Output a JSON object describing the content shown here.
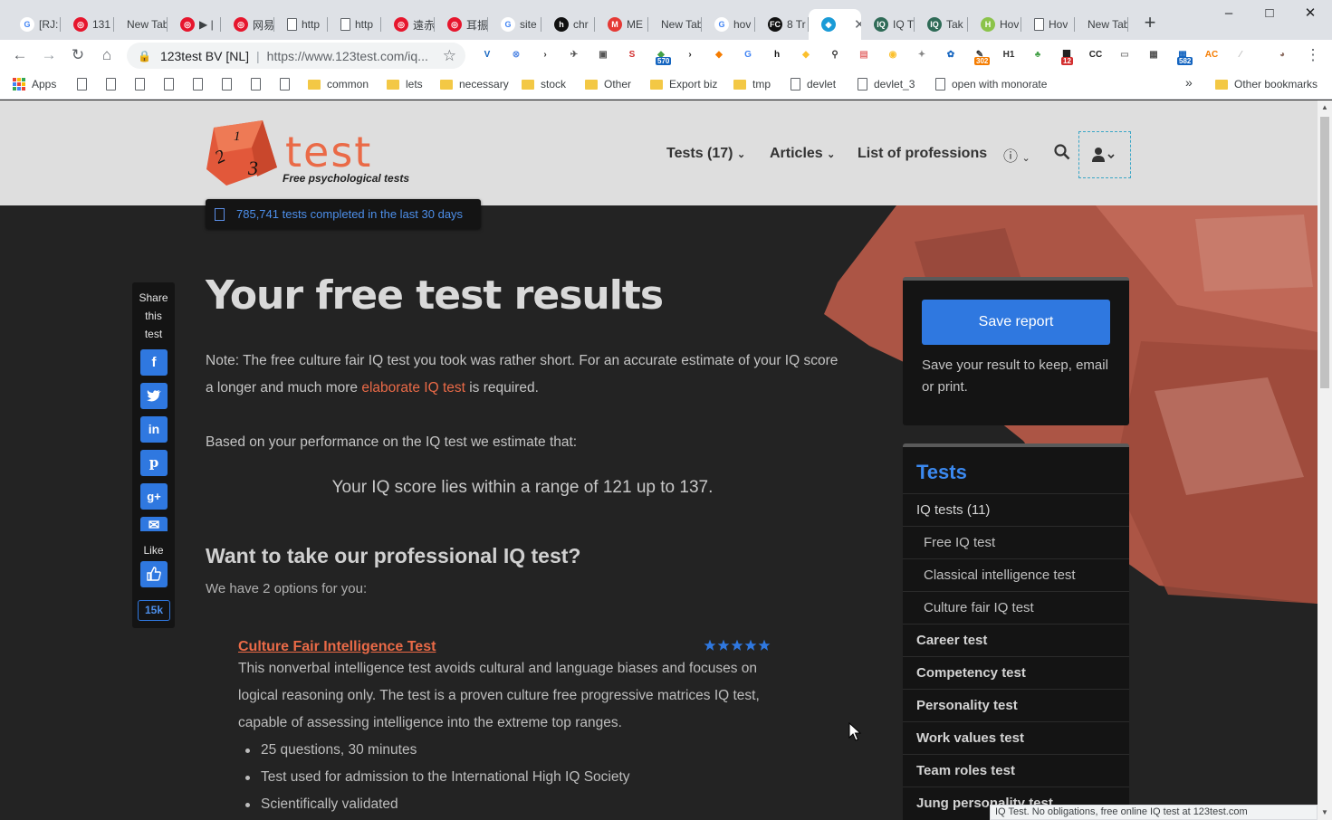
{
  "browser": {
    "tabs": [
      {
        "title": "[RJ:",
        "icon": "google-icon",
        "color": "#4285f4"
      },
      {
        "title": "131",
        "icon": "weibo-icon",
        "color": "#e6162d"
      },
      {
        "title": "New Tab",
        "icon": "none",
        "color": ""
      },
      {
        "title": "▶ |",
        "icon": "weibo-icon",
        "color": "#e6162d"
      },
      {
        "title": "网易",
        "icon": "weibo-icon",
        "color": "#e6162d"
      },
      {
        "title": "http",
        "icon": "page-icon",
        "color": ""
      },
      {
        "title": "http",
        "icon": "page-icon",
        "color": ""
      },
      {
        "title": "遠赤",
        "icon": "weibo-icon",
        "color": "#e6162d"
      },
      {
        "title": "耳振",
        "icon": "weibo-icon",
        "color": "#e6162d"
      },
      {
        "title": "site",
        "icon": "google-icon",
        "color": "#4285f4"
      },
      {
        "title": "chr",
        "icon": "h-icon",
        "color": "#111111"
      },
      {
        "title": "ME",
        "icon": "m-icon",
        "color": "#e53935"
      },
      {
        "title": "New Tab",
        "icon": "none",
        "color": ""
      },
      {
        "title": "hov",
        "icon": "google-icon",
        "color": "#4285f4"
      },
      {
        "title": "8 Tr",
        "icon": "fc-icon",
        "color": "#111111"
      },
      {
        "title": "",
        "icon": "cube-icon",
        "color": "#1a9bd7",
        "active": true
      },
      {
        "title": "IQ T",
        "icon": "iq-icon",
        "color": "#2f6b57"
      },
      {
        "title": "Tak",
        "icon": "iq-icon",
        "color": "#2f6b57"
      },
      {
        "title": "Hov",
        "icon": "wikihow-icon",
        "color": "#8bc34a"
      },
      {
        "title": "Hov",
        "icon": "page-icon",
        "color": ""
      },
      {
        "title": "New Tab",
        "icon": "none",
        "color": ""
      }
    ],
    "omnibox": {
      "org": "123test BV [NL]",
      "url": "https://www.123test.com/iq..."
    },
    "extensions": [
      {
        "icon": "v-extension-icon",
        "text": "V",
        "color": "#1565c0",
        "badge": ""
      },
      {
        "icon": "circle-x-extension-icon",
        "text": "⊗",
        "color": "#5b8ee6",
        "badge": ""
      },
      {
        "icon": "arrow-extension-icon",
        "text": "›",
        "color": "#333333",
        "badge": ""
      },
      {
        "icon": "bird-extension-icon",
        "text": "✈",
        "color": "#555555",
        "badge": ""
      },
      {
        "icon": "copy-extension-icon",
        "text": "▣",
        "color": "#555555",
        "badge": ""
      },
      {
        "icon": "seo-extension-icon",
        "text": "S",
        "color": "#d32f2f",
        "badge": ""
      },
      {
        "icon": "robot-extension-icon",
        "text": "◆",
        "color": "#43a047",
        "badge": "570"
      },
      {
        "icon": "play-extension-icon",
        "text": "›",
        "color": "#222222",
        "badge": ""
      },
      {
        "icon": "fox-extension-icon",
        "text": "◆",
        "color": "#f57c00",
        "badge": ""
      },
      {
        "icon": "translate-extension-icon",
        "text": "G",
        "color": "#4285f4",
        "badge": ""
      },
      {
        "icon": "h-extension-icon",
        "text": "h",
        "color": "#111111",
        "badge": ""
      },
      {
        "icon": "diamond-extension-icon",
        "text": "◆",
        "color": "#fbc02d",
        "badge": ""
      },
      {
        "icon": "magnifier-extension-icon",
        "text": "⚲",
        "color": "#333333",
        "badge": ""
      },
      {
        "icon": "calendar-extension-icon",
        "text": "▤",
        "color": "#e57373",
        "badge": ""
      },
      {
        "icon": "shield-extension-icon",
        "text": "◉",
        "color": "#fbc02d",
        "badge": ""
      },
      {
        "icon": "puzzle-extension-icon",
        "text": "✦",
        "color": "#888888",
        "badge": ""
      },
      {
        "icon": "globe-extension-icon",
        "text": "✿",
        "color": "#1565c0",
        "badge": ""
      },
      {
        "icon": "pen-extension-icon",
        "text": "✎",
        "color": "#333333",
        "badge": "302"
      },
      {
        "icon": "h1-extension-icon",
        "text": "H1",
        "color": "#333333",
        "badge": ""
      },
      {
        "icon": "clover-extension-icon",
        "text": "♣",
        "color": "#43a047",
        "badge": ""
      },
      {
        "icon": "notes-extension-icon",
        "text": "▇",
        "color": "#222222",
        "badge": "12"
      },
      {
        "icon": "cc-extension-icon",
        "text": "CC",
        "color": "#222222",
        "badge": ""
      },
      {
        "icon": "box-extension-icon",
        "text": "▭",
        "color": "#888888",
        "badge": ""
      },
      {
        "icon": "calc-extension-icon",
        "text": "▦",
        "color": "#555555",
        "badge": ""
      },
      {
        "icon": "table-extension-icon",
        "text": "▦",
        "color": "#1565c0",
        "badge": "582"
      },
      {
        "icon": "ac-extension-icon",
        "text": "AC",
        "color": "#f57c00",
        "badge": ""
      },
      {
        "icon": "feather-extension-icon",
        "text": "⁄",
        "color": "#bbbbbb",
        "badge": ""
      },
      {
        "icon": "avatar-icon",
        "text": "◕",
        "color": "#8d6e63",
        "badge": ""
      }
    ],
    "bookmarks": {
      "apps_label": "Apps",
      "page_items": 8,
      "items": [
        {
          "label": "common",
          "type": "folder"
        },
        {
          "label": "lets",
          "type": "folder"
        },
        {
          "label": "necessary",
          "type": "folder"
        },
        {
          "label": "stock",
          "type": "folder"
        },
        {
          "label": "Other",
          "type": "folder"
        },
        {
          "label": "Export biz",
          "type": "folder"
        },
        {
          "label": "tmp",
          "type": "folder"
        },
        {
          "label": "devlet",
          "type": "page"
        },
        {
          "label": "devlet_3",
          "type": "page"
        },
        {
          "label": "open with monorate",
          "type": "page"
        }
      ],
      "overflow": "»",
      "other_label": "Other bookmarks"
    },
    "status_text": "IQ Test. No obligations, free online IQ test at 123test.com"
  },
  "site": {
    "logo": {
      "text": "test",
      "tagline": "Free psychological tests",
      "cube_digits": [
        "1",
        "2",
        "3"
      ],
      "accent": "#ea6a47"
    },
    "nav": {
      "tests": "Tests (17)",
      "articles": "Articles",
      "professions": "List of professions"
    },
    "counter": "785,741 tests completed in the last 30 days",
    "share": {
      "label_lines": [
        "Share",
        "this",
        "test"
      ],
      "like_label": "Like",
      "like_count": "15k"
    },
    "main": {
      "title": "Your free test results",
      "note_before": "Note: The free culture fair IQ test you took was rather short. For an accurate estimate of your IQ score a longer and much more ",
      "note_link": "elaborate IQ test",
      "note_after": " is required.",
      "estimate_intro": "Based on your performance on the IQ test we estimate that:",
      "iq_range": "Your IQ score lies within a range of 121 up to 137.",
      "pro_heading": "Want to take our professional IQ test?",
      "options_text": "We have 2 options for you:",
      "option1": {
        "title": "Culture Fair Intelligence Test",
        "rating": 5,
        "description": "This nonverbal intelligence test avoids cultural and language biases and focuses on logical reasoning only. The test is a proven culture free progressive matrices IQ test, capable of assessing intelligence into the extreme top ranges.",
        "bullets": [
          "25 questions, 30 minutes",
          "Test used for admission to the International High IQ Society",
          "Scientifically validated"
        ]
      }
    },
    "save_card": {
      "button": "Save report",
      "description": "Save your result to keep, email or print."
    },
    "tests_card": {
      "heading": "Tests",
      "items": [
        {
          "label": "IQ tests (11)",
          "level": "cat-plain"
        },
        {
          "label": "Free IQ test",
          "level": "sub"
        },
        {
          "label": "Classical intelligence test",
          "level": "sub"
        },
        {
          "label": "Culture fair IQ test",
          "level": "sub"
        },
        {
          "label": "Career test",
          "level": "cat"
        },
        {
          "label": "Competency test",
          "level": "cat"
        },
        {
          "label": "Personality test",
          "level": "cat"
        },
        {
          "label": "Work values test",
          "level": "cat"
        },
        {
          "label": "Team roles test",
          "level": "cat"
        },
        {
          "label": "Jung personality test",
          "level": "cat"
        }
      ]
    },
    "colors": {
      "link": "#ea6a47",
      "primary": "#2f78e0",
      "heading_blue": "#3b89ef",
      "page_bg": "#232323",
      "card_bg": "#141414"
    }
  }
}
